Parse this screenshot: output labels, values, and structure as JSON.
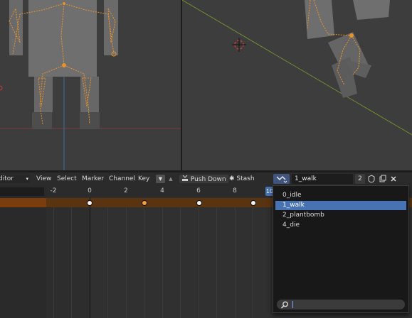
{
  "header": {
    "editor_label": "ditor",
    "menu": [
      "View",
      "Select",
      "Marker",
      "Channel",
      "Key"
    ],
    "push_down": "Push Down",
    "stash": "Stash",
    "action_name": "1_walk",
    "users_count": "2"
  },
  "timeline": {
    "ticks": [
      "-2",
      "0",
      "2",
      "4",
      "6",
      "8"
    ],
    "current_frame": "10"
  },
  "dropdown": {
    "items": [
      "0_idle",
      "1_walk",
      "2_plantbomb",
      "4_die"
    ],
    "selected_index": 1
  },
  "colors": {
    "accent": "#4772b3",
    "summary_row": "#5a3410",
    "selected_key": "#f0a040",
    "rig_orange": "#e8922a"
  },
  "icons": [
    "action-browse-icon",
    "shield-icon",
    "copy-icon",
    "close-icon",
    "search-icon",
    "stash-icon",
    "push-down-icon"
  ]
}
